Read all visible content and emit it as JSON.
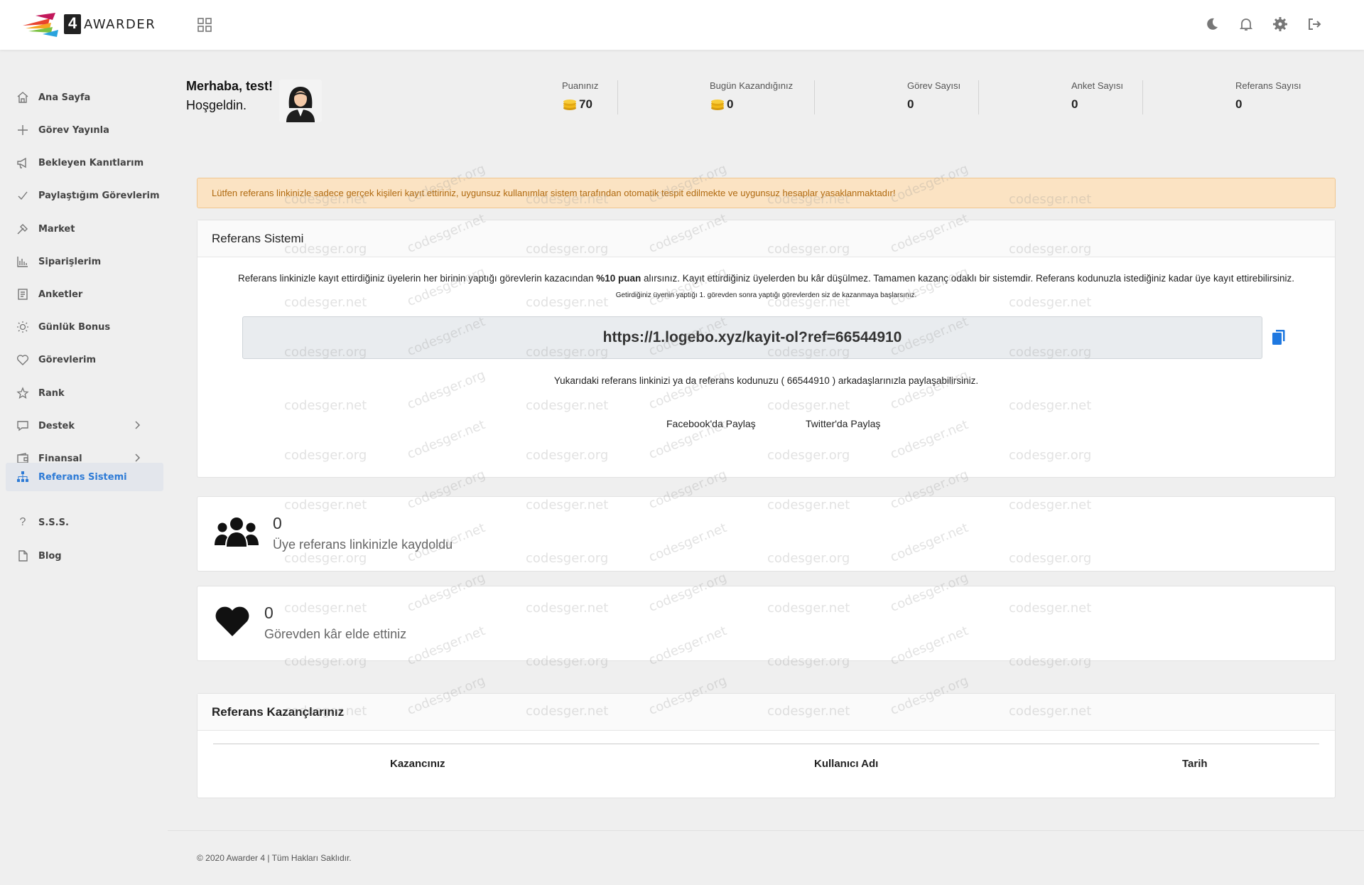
{
  "app": {
    "logo_number": "4",
    "logo_text": "AWARDER"
  },
  "topbar_icons": [
    "moon-icon",
    "bell-icon",
    "gear-icon",
    "logout-icon"
  ],
  "sidebar": {
    "items": [
      {
        "label": "Ana Sayfa",
        "icon": "home-icon"
      },
      {
        "label": "Görev Yayınla",
        "icon": "plus-icon"
      },
      {
        "label": "Bekleyen Kanıtlarım",
        "icon": "megaphone-icon"
      },
      {
        "label": "Paylaştığım Görevlerim",
        "icon": "check-icon"
      },
      {
        "label": "Market",
        "icon": "market-icon"
      },
      {
        "label": "Siparişlerim",
        "icon": "chart-icon"
      },
      {
        "label": "Anketler",
        "icon": "document-icon"
      },
      {
        "label": "Günlük Bonus",
        "icon": "sun-icon"
      },
      {
        "label": "Görevlerim",
        "icon": "heart-icon"
      },
      {
        "label": "Rank",
        "icon": "star-icon"
      },
      {
        "label": "Destek",
        "icon": "chat-icon"
      },
      {
        "label": "Finansal",
        "icon": "wallet-icon"
      },
      {
        "label": "Referans Sistemi",
        "icon": "sitemap-icon"
      },
      {
        "label": "S.S.S.",
        "icon": "question-icon"
      },
      {
        "label": "Blog",
        "icon": "file-icon"
      }
    ]
  },
  "greeting": {
    "hello": "Merhaba, test!",
    "welcome": "Hoşgeldin."
  },
  "stats": {
    "points_label": "Puanınız",
    "points_value": "70",
    "today_label": "Bugün Kazandığınız",
    "today_value": "0",
    "tasks_label": "Görev Sayısı",
    "tasks_value": "0",
    "surveys_label": "Anket Sayısı",
    "surveys_value": "0",
    "refs_label": "Referans Sayısı",
    "refs_value": "0"
  },
  "alert": "Lütfen referans linkinizle sadece gerçek kişileri kayıt ettiriniz, uygunsuz kullanımlar sistem tarafından otomatik tespit edilmekte ve uygunsuz hesaplar yasaklanmaktadır!",
  "referral": {
    "title": "Referans Sistemi",
    "desc_part1": "Referans linkinizle kayıt ettirdiğiniz üyelerin her birinin yaptığı görevlerin kazacından ",
    "desc_bold": "%10 puan",
    "desc_part2": " alırsınız. Kayıt ettirdiğiniz üyelerden bu kâr düşülmez. Tamamen kazanç odaklı bir sistemdir. Referans kodunuzla istediğiniz kadar üye kayıt ettirebilirsiniz.",
    "small_note": "Getirdiğiniz üyenin yaptığı 1. görevden sonra yaptığı görevlerden siz de kazanmaya başlarsınız.",
    "link": "https://1.logebo.xyz/kayit-ol?ref=66544910",
    "code_part1": "Yukarıdaki referans linkinizi ya da referans kodunuzu ( ",
    "code": "66544910",
    "code_part2": " ) arkadaşlarınızla paylaşabilirsiniz.",
    "facebook": "Facebook'da Paylaş",
    "twitter": "Twitter'da Paylaş"
  },
  "members_card": {
    "count": "0",
    "text": "Üye referans linkinizle kaydoldu"
  },
  "profit_card": {
    "count": "0",
    "text": "Görevden kâr elde ettiniz"
  },
  "earnings": {
    "title": "Referans Kazançlarınız",
    "columns": [
      "Kazancınız",
      "Kullanıcı Adı",
      "Tarih"
    ]
  },
  "footer": "© 2020 Awarder 4 | Tüm Hakları Saklıdır.",
  "watermarks": [
    "codesger.net",
    "codesger.org"
  ],
  "colors": {
    "accent": "#2e7bd6",
    "alert_bg": "#fbe3c3",
    "alert_text": "#b06a10"
  }
}
